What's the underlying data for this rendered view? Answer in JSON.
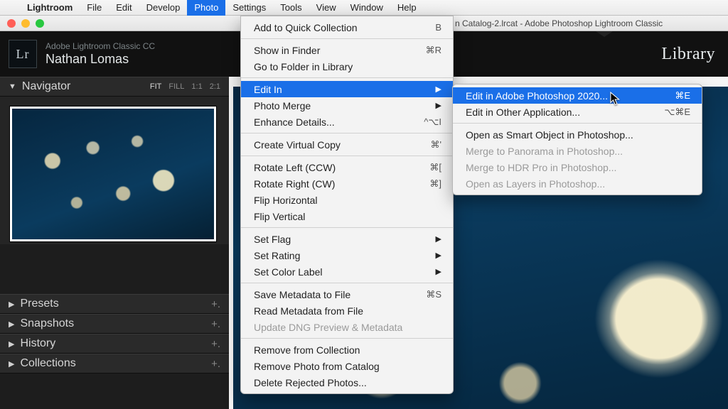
{
  "menubar": {
    "app": "Lightroom",
    "items": [
      "File",
      "Edit",
      "Develop",
      "Photo",
      "Settings",
      "Tools",
      "View",
      "Window",
      "Help"
    ],
    "active_index": 3
  },
  "window_title": "n Catalog-2.lrcat - Adobe Photoshop Lightroom Classic",
  "identity": {
    "product": "Adobe Lightroom Classic CC",
    "user": "Nathan Lomas",
    "logo": "Lr"
  },
  "module": "Library",
  "navigator": {
    "title": "Navigator",
    "modes": [
      "FIT",
      "FILL",
      "1:1",
      "2:1"
    ],
    "active_mode": "FIT"
  },
  "panels": [
    {
      "label": "Presets"
    },
    {
      "label": "Snapshots"
    },
    {
      "label": "History"
    },
    {
      "label": "Collections"
    }
  ],
  "photo_menu": [
    {
      "type": "item",
      "label": "Add to Quick Collection",
      "shortcut": "B"
    },
    {
      "type": "sep"
    },
    {
      "type": "item",
      "label": "Show in Finder",
      "shortcut": "⌘R"
    },
    {
      "type": "item",
      "label": "Go to Folder in Library",
      "shortcut": ""
    },
    {
      "type": "sep"
    },
    {
      "type": "submenu",
      "label": "Edit In",
      "selected": true
    },
    {
      "type": "submenu",
      "label": "Photo Merge"
    },
    {
      "type": "item",
      "label": "Enhance Details...",
      "shortcut": "^⌥I"
    },
    {
      "type": "sep"
    },
    {
      "type": "item",
      "label": "Create Virtual Copy",
      "shortcut": "⌘'"
    },
    {
      "type": "sep"
    },
    {
      "type": "item",
      "label": "Rotate Left (CCW)",
      "shortcut": "⌘["
    },
    {
      "type": "item",
      "label": "Rotate Right (CW)",
      "shortcut": "⌘]"
    },
    {
      "type": "item",
      "label": "Flip Horizontal",
      "shortcut": ""
    },
    {
      "type": "item",
      "label": "Flip Vertical",
      "shortcut": ""
    },
    {
      "type": "sep"
    },
    {
      "type": "submenu",
      "label": "Set Flag"
    },
    {
      "type": "submenu",
      "label": "Set Rating"
    },
    {
      "type": "submenu",
      "label": "Set Color Label"
    },
    {
      "type": "sep"
    },
    {
      "type": "item",
      "label": "Save Metadata to File",
      "shortcut": "⌘S"
    },
    {
      "type": "item",
      "label": "Read Metadata from File",
      "shortcut": ""
    },
    {
      "type": "item",
      "label": "Update DNG Preview & Metadata",
      "shortcut": "",
      "disabled": true
    },
    {
      "type": "sep"
    },
    {
      "type": "item",
      "label": "Remove from Collection",
      "shortcut": ""
    },
    {
      "type": "item",
      "label": "Remove Photo from Catalog",
      "shortcut": ""
    },
    {
      "type": "item",
      "label": "Delete Rejected Photos...",
      "shortcut": ""
    }
  ],
  "editin_submenu": [
    {
      "label": "Edit in Adobe Photoshop 2020...",
      "shortcut": "⌘E",
      "selected": true
    },
    {
      "label": "Edit in Other Application...",
      "shortcut": "⌥⌘E"
    },
    {
      "sep": true
    },
    {
      "label": "Open as Smart Object in Photoshop..."
    },
    {
      "label": "Merge to Panorama in Photoshop...",
      "disabled": true
    },
    {
      "label": "Merge to HDR Pro in Photoshop...",
      "disabled": true
    },
    {
      "label": "Open as Layers in Photoshop...",
      "disabled": true
    }
  ]
}
